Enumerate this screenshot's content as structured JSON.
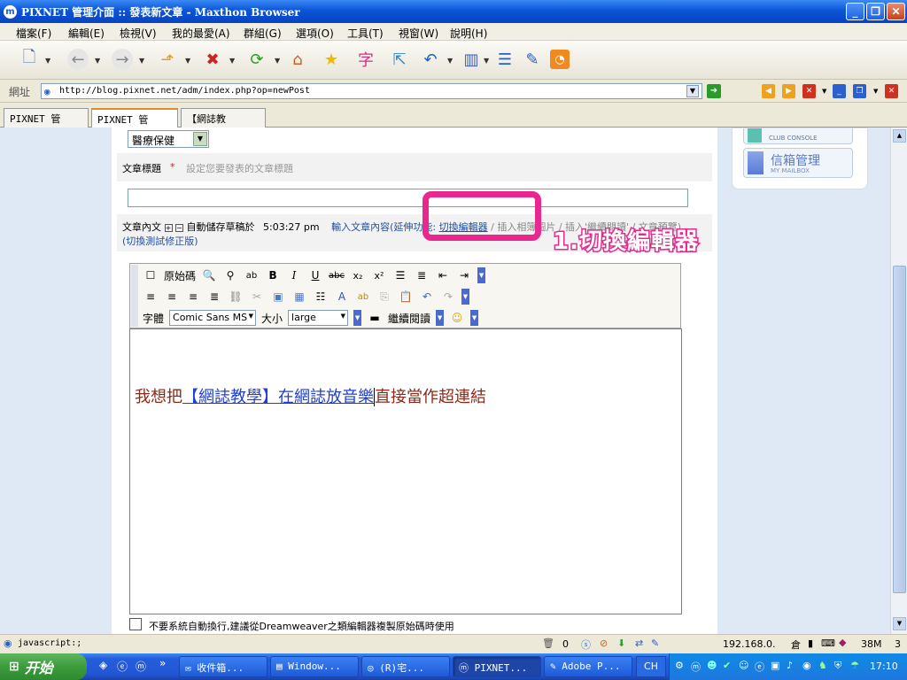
{
  "window": {
    "title": "PIXNET 管理介面 :: 發表新文章 - Maxthon Browser",
    "icon": "maxthon-icon"
  },
  "menu": [
    "檔案(F)",
    "編輯(E)",
    "檢視(V)",
    "我的最愛(A)",
    "群組(G)",
    "選項(O)",
    "工具(T)",
    "視窗(W)",
    "說明(H)"
  ],
  "address": {
    "label": "網址",
    "url": "http://blog.pixnet.net/adm/index.php?op=newPost"
  },
  "tabs": [
    "PIXNET 管理...",
    "PIXNET 管理...",
    "【網誌教學】..."
  ],
  "form": {
    "category_value": "醫療保健",
    "title_label": "文章標題",
    "title_required": "*",
    "title_hint": "設定您要發表的文章標題",
    "content_label": "文章內文",
    "autosave_label": "自動儲存草稿於",
    "autosave_time": "5:03:27 pm",
    "input_content_link": "輸入文章內容(",
    "extend_features": "延伸功能:",
    "switch_editor_link": "切換編輯器",
    "insert_album": "/ 插入相簿圖片",
    "insert_more": "/ 插入'繼續閱讀'",
    "article_preview": "/ 文章預覽)",
    "switch_test": "(切換測試修正版)",
    "checkbox_note": "不要系統自動換行,建議從Dreamweaver之類編輯器複製原始碼時使用"
  },
  "annotation": {
    "text": "1.切換編輯器",
    "color": "#e8288f"
  },
  "editor": {
    "source_label": "原始碼",
    "font_label": "字體",
    "font_value": "Comic Sans MS",
    "size_label": "大小",
    "size_value": "large",
    "more_label": "繼續閱讀",
    "text_before": "我想把",
    "link_text": "【網誌教學】在網誌放音樂",
    "text_after": "直接當作超連結",
    "text_color": "#8b2a1a",
    "link_color": "#1f3fd0"
  },
  "sidebar": {
    "club_console_cn": "",
    "club_console_en": "CLUB CONSOLE",
    "mailbox_cn": "信箱管理",
    "mailbox_en": "MY MAILBOX"
  },
  "status": {
    "text": "javascript:;",
    "count": "0",
    "ip": "192.168.0.",
    "mem": "38M",
    "num": "3",
    "ime": "倉"
  },
  "taskbar": {
    "start": "开始",
    "tasks": [
      "收件箱...",
      "Window...",
      "(R)宅...",
      "PIXNET...",
      "Adobe P..."
    ],
    "lang": "CH",
    "clock": "17:10"
  }
}
